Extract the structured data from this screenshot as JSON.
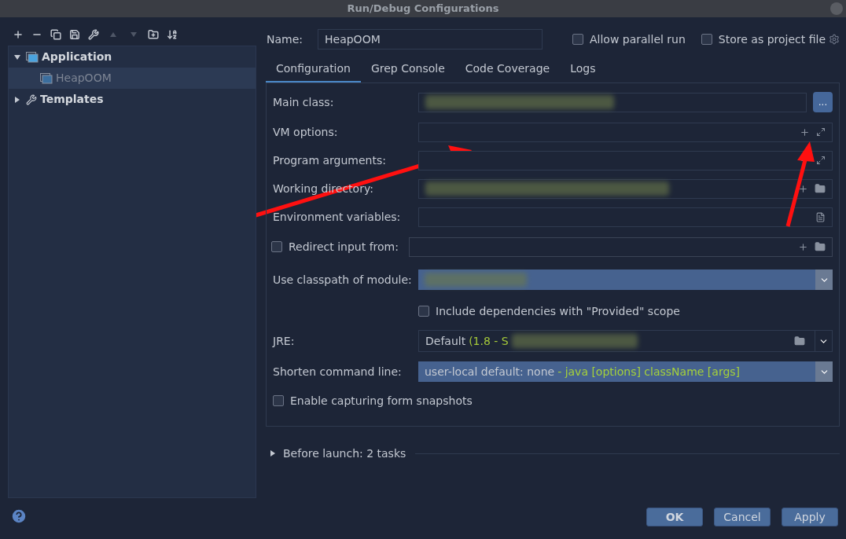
{
  "window": {
    "title": "Run/Debug Configurations"
  },
  "toolbar": [
    {
      "kind": "add",
      "disabled": false
    },
    {
      "kind": "remove",
      "disabled": false
    },
    {
      "kind": "copy",
      "disabled": false
    },
    {
      "kind": "save",
      "disabled": false
    },
    {
      "kind": "wrench",
      "disabled": false
    },
    {
      "kind": "up",
      "disabled": true
    },
    {
      "kind": "down",
      "disabled": true
    },
    {
      "kind": "folder",
      "disabled": false
    },
    {
      "kind": "sort",
      "disabled": false
    }
  ],
  "tree": [
    {
      "label": "Application",
      "kind": "application",
      "expanded": true,
      "selected": false,
      "children": [
        {
          "label": "HeapOOM",
          "kind": "application",
          "selected": true
        }
      ]
    },
    {
      "label": "Templates",
      "kind": "templates",
      "expanded": false,
      "selected": false
    }
  ],
  "name": {
    "label": "Name:",
    "value": "HeapOOM"
  },
  "options": [
    {
      "label": "Allow parallel run",
      "checked": false
    },
    {
      "label": "Store as project file",
      "checked": false
    }
  ],
  "tabs": [
    {
      "label": "Configuration",
      "selected": true
    },
    {
      "label": "Grep Console",
      "selected": false
    },
    {
      "label": "Code Coverage",
      "selected": false
    },
    {
      "label": "Logs",
      "selected": false
    }
  ],
  "fields": [
    {
      "kind": "browse",
      "label": "Main class:",
      "redacted": true,
      "button": "..."
    },
    {
      "kind": "expand",
      "label": "VM options:"
    },
    {
      "kind": "expand",
      "label": "Program arguments:"
    },
    {
      "kind": "dir",
      "label": "Working directory:",
      "redacted": true
    },
    {
      "kind": "env",
      "label": "Environment variables:"
    },
    {
      "kind": "checkfield",
      "label": "Redirect input from:",
      "checked": false
    },
    {
      "kind": "module",
      "label": "Use classpath of module:",
      "redacted": true
    },
    {
      "kind": "check",
      "label": "Include dependencies with \"Provided\" scope",
      "checked": false
    },
    {
      "kind": "jre",
      "label": "JRE:",
      "value": "Default",
      "detail": "(1.8 - S",
      "redacted": true
    },
    {
      "kind": "combo",
      "label": "Shorten command line:",
      "value": "user-local default: none",
      "detail": "- java [options] className [args]"
    },
    {
      "kind": "check",
      "label": "Enable capturing form snapshots",
      "checked": false
    }
  ],
  "before_launch": {
    "label": "Before launch: 2 tasks",
    "expanded": false
  },
  "buttons": [
    {
      "label": "OK",
      "default": true
    },
    {
      "label": "Cancel",
      "default": false
    },
    {
      "label": "Apply",
      "default": false
    }
  ]
}
